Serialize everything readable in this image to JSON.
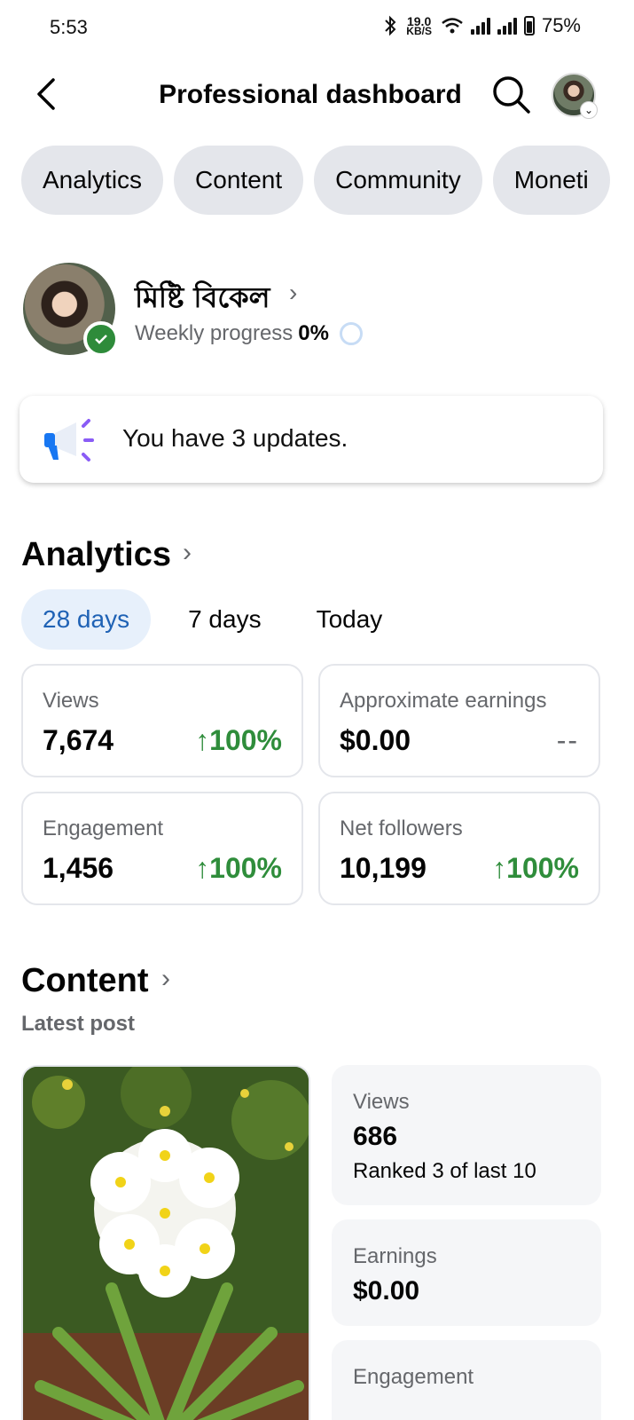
{
  "status_bar": {
    "time": "5:53",
    "net_speed_value": "19.0",
    "net_speed_unit": "KB/S",
    "battery": "75%"
  },
  "header": {
    "title": "Professional dashboard"
  },
  "tabs": [
    "Analytics",
    "Content",
    "Community",
    "Moneti"
  ],
  "profile": {
    "name": "মিষ্টি বিকেল",
    "progress_label": "Weekly progress",
    "progress_value": "0%"
  },
  "updates": {
    "text": "You have 3 updates."
  },
  "analytics": {
    "title": "Analytics",
    "ranges": [
      "28 days",
      "7 days",
      "Today"
    ],
    "metrics": [
      {
        "label": "Views",
        "value": "7,674",
        "delta": "100%"
      },
      {
        "label": "Approximate earnings",
        "value": "$0.00",
        "delta": "--"
      },
      {
        "label": "Engagement",
        "value": "1,456",
        "delta": "100%"
      },
      {
        "label": "Net followers",
        "value": "10,199",
        "delta": "100%"
      }
    ]
  },
  "content": {
    "title": "Content",
    "subtitle": "Latest post",
    "stats": [
      {
        "label": "Views",
        "value": "686",
        "sub": "Ranked 3 of last 10"
      },
      {
        "label": "Earnings",
        "value": "$0.00"
      },
      {
        "label": "Engagement"
      }
    ]
  },
  "colors": {
    "accent_blue": "#1f62b5",
    "positive_green": "#2f8d3b",
    "pill_gray": "#e4e6eb"
  }
}
